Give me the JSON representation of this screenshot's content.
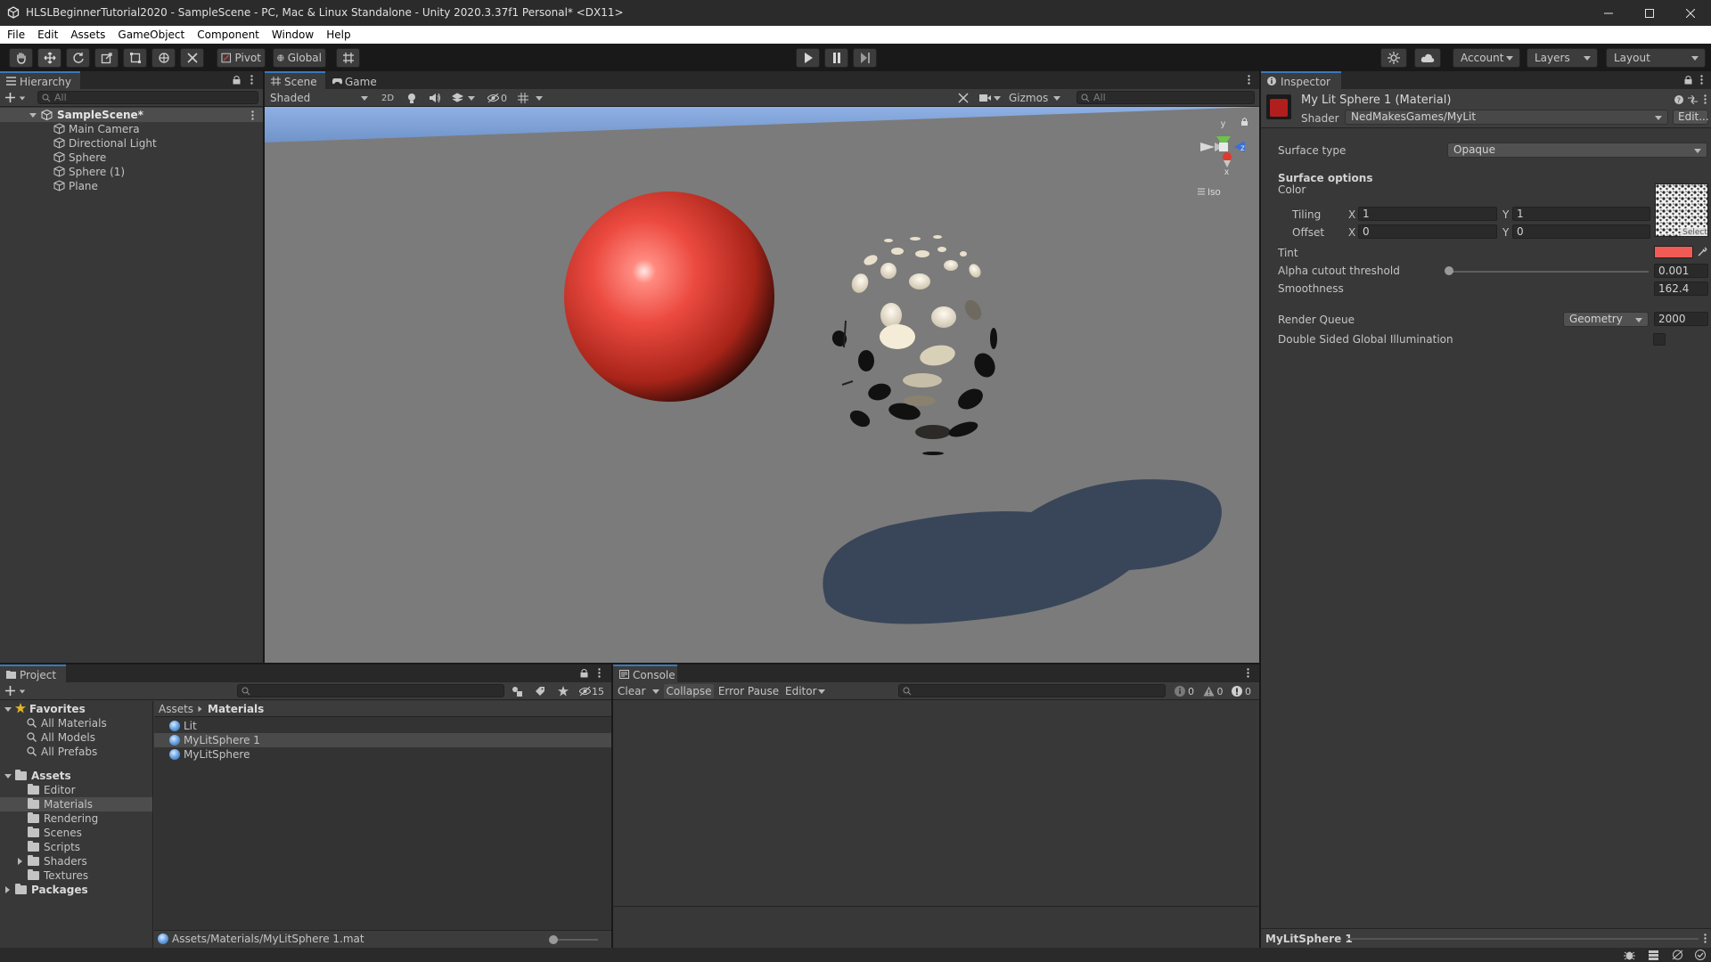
{
  "window": {
    "title": "HLSLBeginnerTutorial2020 - SampleScene - PC, Mac & Linux Standalone - Unity 2020.3.37f1 Personal* <DX11>"
  },
  "menu": [
    "File",
    "Edit",
    "Assets",
    "GameObject",
    "Component",
    "Window",
    "Help"
  ],
  "toolbar": {
    "pivot_label": "Pivot",
    "global_label": "Global",
    "account_label": "Account",
    "layers_label": "Layers",
    "layout_label": "Layout"
  },
  "hierarchy": {
    "tab_label": "Hierarchy",
    "search_placeholder": "All",
    "scene_name": "SampleScene*",
    "items": [
      "Main Camera",
      "Directional Light",
      "Sphere",
      "Sphere (1)",
      "Plane"
    ]
  },
  "scene": {
    "tab_scene": "Scene",
    "tab_game": "Game",
    "shading_mode": "Shaded",
    "mode_2d": "2D",
    "hidden_count": "0",
    "gizmos_label": "Gizmos",
    "search_placeholder": "All",
    "gizmo_y": "y",
    "gizmo_z": "z",
    "gizmo_x": "x",
    "iso_label": "Iso",
    "colors": {
      "sky": "#7ea1d8",
      "ground": "#7b7b7b",
      "shadow": "#394659",
      "red_sphere": "#e3443a"
    }
  },
  "inspector": {
    "tab_label": "Inspector",
    "material_title": "My Lit Sphere 1 (Material)",
    "shader_label": "Shader",
    "shader_value": "NedMakesGames/MyLit",
    "edit_button": "Edit...",
    "surface_type_label": "Surface type",
    "surface_type_value": "Opaque",
    "surface_options_label": "Surface options",
    "color_label": "Color",
    "tiling_label": "Tiling",
    "tiling_x_axis": "X",
    "tiling_x": "1",
    "tiling_y_axis": "Y",
    "tiling_y": "1",
    "offset_label": "Offset",
    "offset_x_axis": "X",
    "offset_x": "0",
    "offset_y_axis": "Y",
    "offset_y": "0",
    "texture_select": "Select",
    "tint_label": "Tint",
    "tint_color": "#f25a55",
    "alpha_label": "Alpha cutout threshold",
    "alpha_value": "0.001",
    "alpha_fraction": 0.001,
    "smoothness_label": "Smoothness",
    "smoothness_value": "162.4",
    "render_queue_label": "Render Queue",
    "render_queue_mode": "Geometry",
    "render_queue_value": "2000",
    "double_sided_label": "Double Sided Global Illumination",
    "footer_label": "MyLitSphere 1"
  },
  "project": {
    "tab_label": "Project",
    "hidden_count": "15",
    "favorites_label": "Favorites",
    "favorites": [
      "All Materials",
      "All Models",
      "All Prefabs"
    ],
    "assets_label": "Assets",
    "asset_folders": [
      "Editor",
      "Materials",
      "Rendering",
      "Scenes",
      "Scripts",
      "Shaders",
      "Textures"
    ],
    "packages_label": "Packages",
    "breadcrumb": [
      "Assets",
      "Materials"
    ],
    "files": [
      "Lit",
      "MyLitSphere 1",
      "MyLitSphere"
    ],
    "footer_path": "Assets/Materials/MyLitSphere 1.mat"
  },
  "console": {
    "tab_label": "Console",
    "clear_label": "Clear",
    "collapse_label": "Collapse",
    "error_pause_label": "Error Pause",
    "editor_label": "Editor",
    "log_count": "0",
    "warning_count": "0",
    "error_count": "0"
  }
}
